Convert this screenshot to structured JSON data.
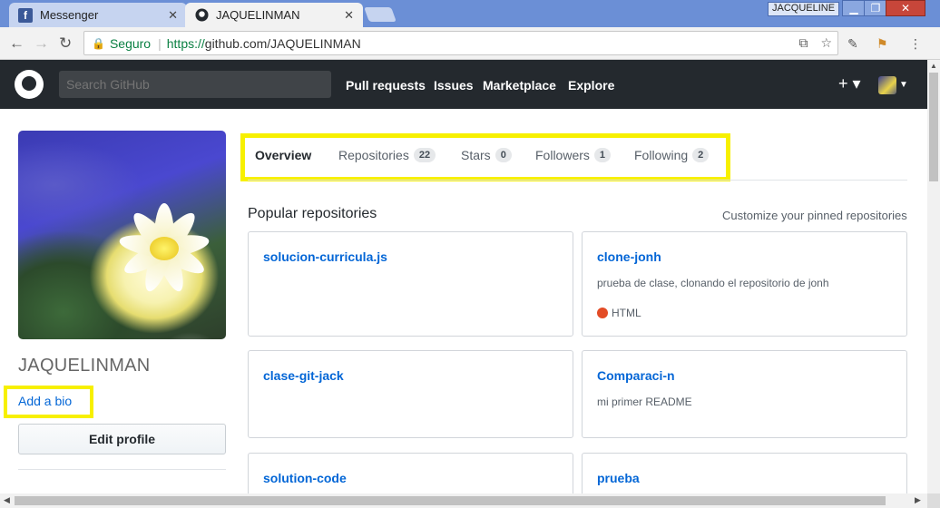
{
  "browser": {
    "tabs": [
      {
        "title": "Messenger",
        "icon": "facebook-icon"
      },
      {
        "title": "JAQUELINMAN",
        "icon": "github-icon"
      }
    ],
    "user_chip": "JACQUELINE",
    "omnibox": {
      "secure_label": "Seguro",
      "url_scheme": "https://",
      "url_rest": "github.com/JAQUELINMAN"
    }
  },
  "header": {
    "search_placeholder": "Search GitHub",
    "nav": [
      "Pull requests",
      "Issues",
      "Marketplace",
      "Explore"
    ],
    "plus_label": "+ ▾"
  },
  "profile": {
    "username": "JAQUELINMAN",
    "add_bio": "Add a bio",
    "edit_profile": "Edit profile"
  },
  "tabs": [
    {
      "label": "Overview",
      "count": null
    },
    {
      "label": "Repositories",
      "count": "22"
    },
    {
      "label": "Stars",
      "count": "0"
    },
    {
      "label": "Followers",
      "count": "1"
    },
    {
      "label": "Following",
      "count": "2"
    }
  ],
  "popular": {
    "title": "Popular repositories",
    "customize": "Customize your pinned repositories",
    "repos": [
      {
        "name": "solucion-curricula.js",
        "description": "",
        "language": ""
      },
      {
        "name": "clone-jonh",
        "description": "prueba de clase, clonando el repositorio de jonh",
        "language": "HTML",
        "language_color": "#e34c26"
      },
      {
        "name": "clase-git-jack",
        "description": "",
        "language": ""
      },
      {
        "name": "Comparaci-n",
        "description": "mi primer README",
        "language": ""
      },
      {
        "name": "solution-code",
        "description": "",
        "language": ""
      },
      {
        "name": "prueba",
        "description": "",
        "language": ""
      }
    ]
  },
  "colors": {
    "highlight": "#f7f000",
    "link": "#0366d6",
    "header_bg": "#24292e"
  }
}
